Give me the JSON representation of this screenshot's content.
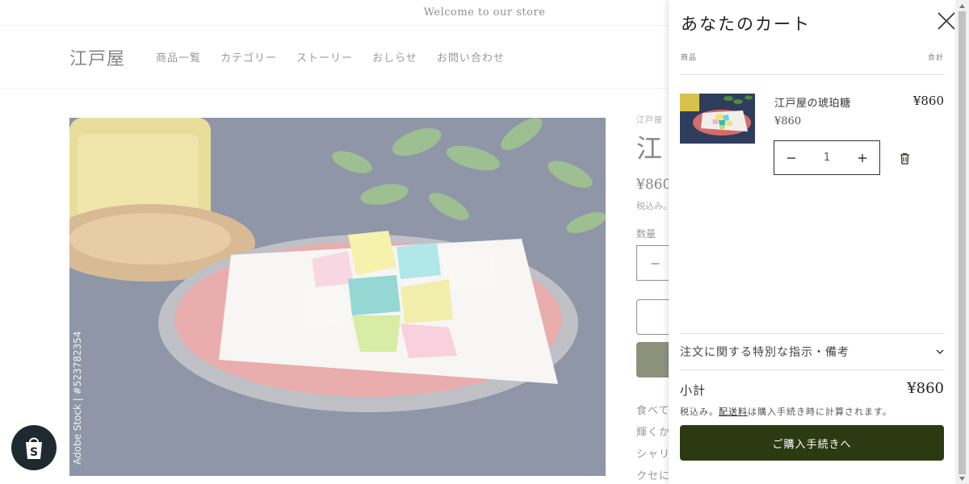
{
  "store": {
    "announcement": "Welcome to our store",
    "logo": "江戸屋",
    "nav": [
      "商品一覧",
      "カテゴリー",
      "ストーリー",
      "おしらせ",
      "お問い合わせ"
    ],
    "product": {
      "vendor": "江戸屋",
      "title_partial": "江",
      "price_partial": "¥860",
      "tax_partial": "税込み。",
      "quantity_label": "数量",
      "quantity_partial": "−",
      "description_lines": [
        "食べて",
        "輝くか",
        "シャリ",
        "クセに"
      ],
      "image_watermark": "Adobe Stock | #523782354"
    }
  },
  "cart": {
    "title": "あなたのカート",
    "close_label": "閉じる",
    "column_product": "商品",
    "column_total": "合計",
    "items": [
      {
        "name": "江戸屋の琥珀糖",
        "unit_price": "¥860",
        "line_total": "¥860",
        "quantity": "1"
      }
    ],
    "notes_label": "注文に関する特別な指示・備考",
    "subtotal_label": "小計",
    "subtotal_value": "¥860",
    "tax_note_prefix": "税込み。",
    "tax_note_link": "配送料",
    "tax_note_suffix": "は購入手続き時に計算されます。",
    "checkout_label": "ご購入手続きへ"
  },
  "colors": {
    "accent": "#2c3a12",
    "image_bg": "#2b3a58"
  },
  "icons": {
    "close": "close-icon",
    "minus": "minus-icon",
    "plus": "plus-icon",
    "trash": "trash-icon",
    "chevron": "chevron-down-icon",
    "shopify": "shopify-bag-icon"
  }
}
